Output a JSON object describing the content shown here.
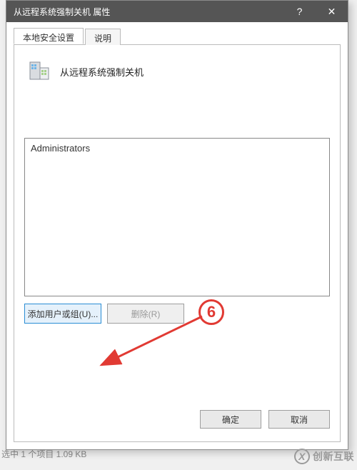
{
  "titlebar": {
    "title": "从远程系统强制关机 属性",
    "help_label": "?",
    "close_label": "✕"
  },
  "tabs": {
    "active": "本地安全设置",
    "secondary": "说明"
  },
  "policy": {
    "title": "从远程系统强制关机"
  },
  "list": {
    "items": [
      "Administrators"
    ]
  },
  "actions": {
    "add_label": "添加用户或组(U)...",
    "remove_label": "删除(R)"
  },
  "footer": {
    "ok": "确定",
    "cancel": "取消"
  },
  "annotation": {
    "number": "6"
  },
  "watermark": {
    "text": "创新互联"
  },
  "background": {
    "status": "选中 1 个项目  1.09 KB"
  }
}
